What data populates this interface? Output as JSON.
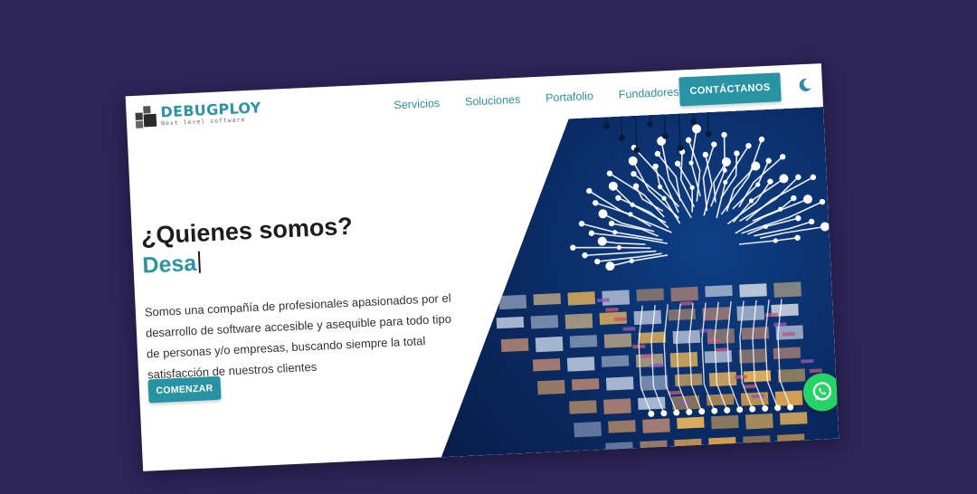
{
  "brand": {
    "name": "DEBUGPLOY",
    "tagline": "Next level software"
  },
  "nav": {
    "items": [
      {
        "label": "Servicios"
      },
      {
        "label": "Soluciones"
      },
      {
        "label": "Portafolio"
      },
      {
        "label": "Fundadores"
      }
    ],
    "cta": "CONTÁCTANOS"
  },
  "hero": {
    "title": "¿Quienes somos?",
    "typed_text": "Desa",
    "description": "Somos una compañía de profesionales apasionados por el desarrollo de software accesible y asequible para todo tipo de personas y/o empresas, buscando siempre la total satisfacción de nuestros clientes",
    "button": "COMENZAR"
  },
  "colors": {
    "background": "#2d2458",
    "accent": "#2894a3",
    "whatsapp": "#25d366"
  },
  "icons": [
    "logo-mark",
    "moon-icon",
    "whatsapp-icon",
    "circuit-brain-illustration"
  ]
}
